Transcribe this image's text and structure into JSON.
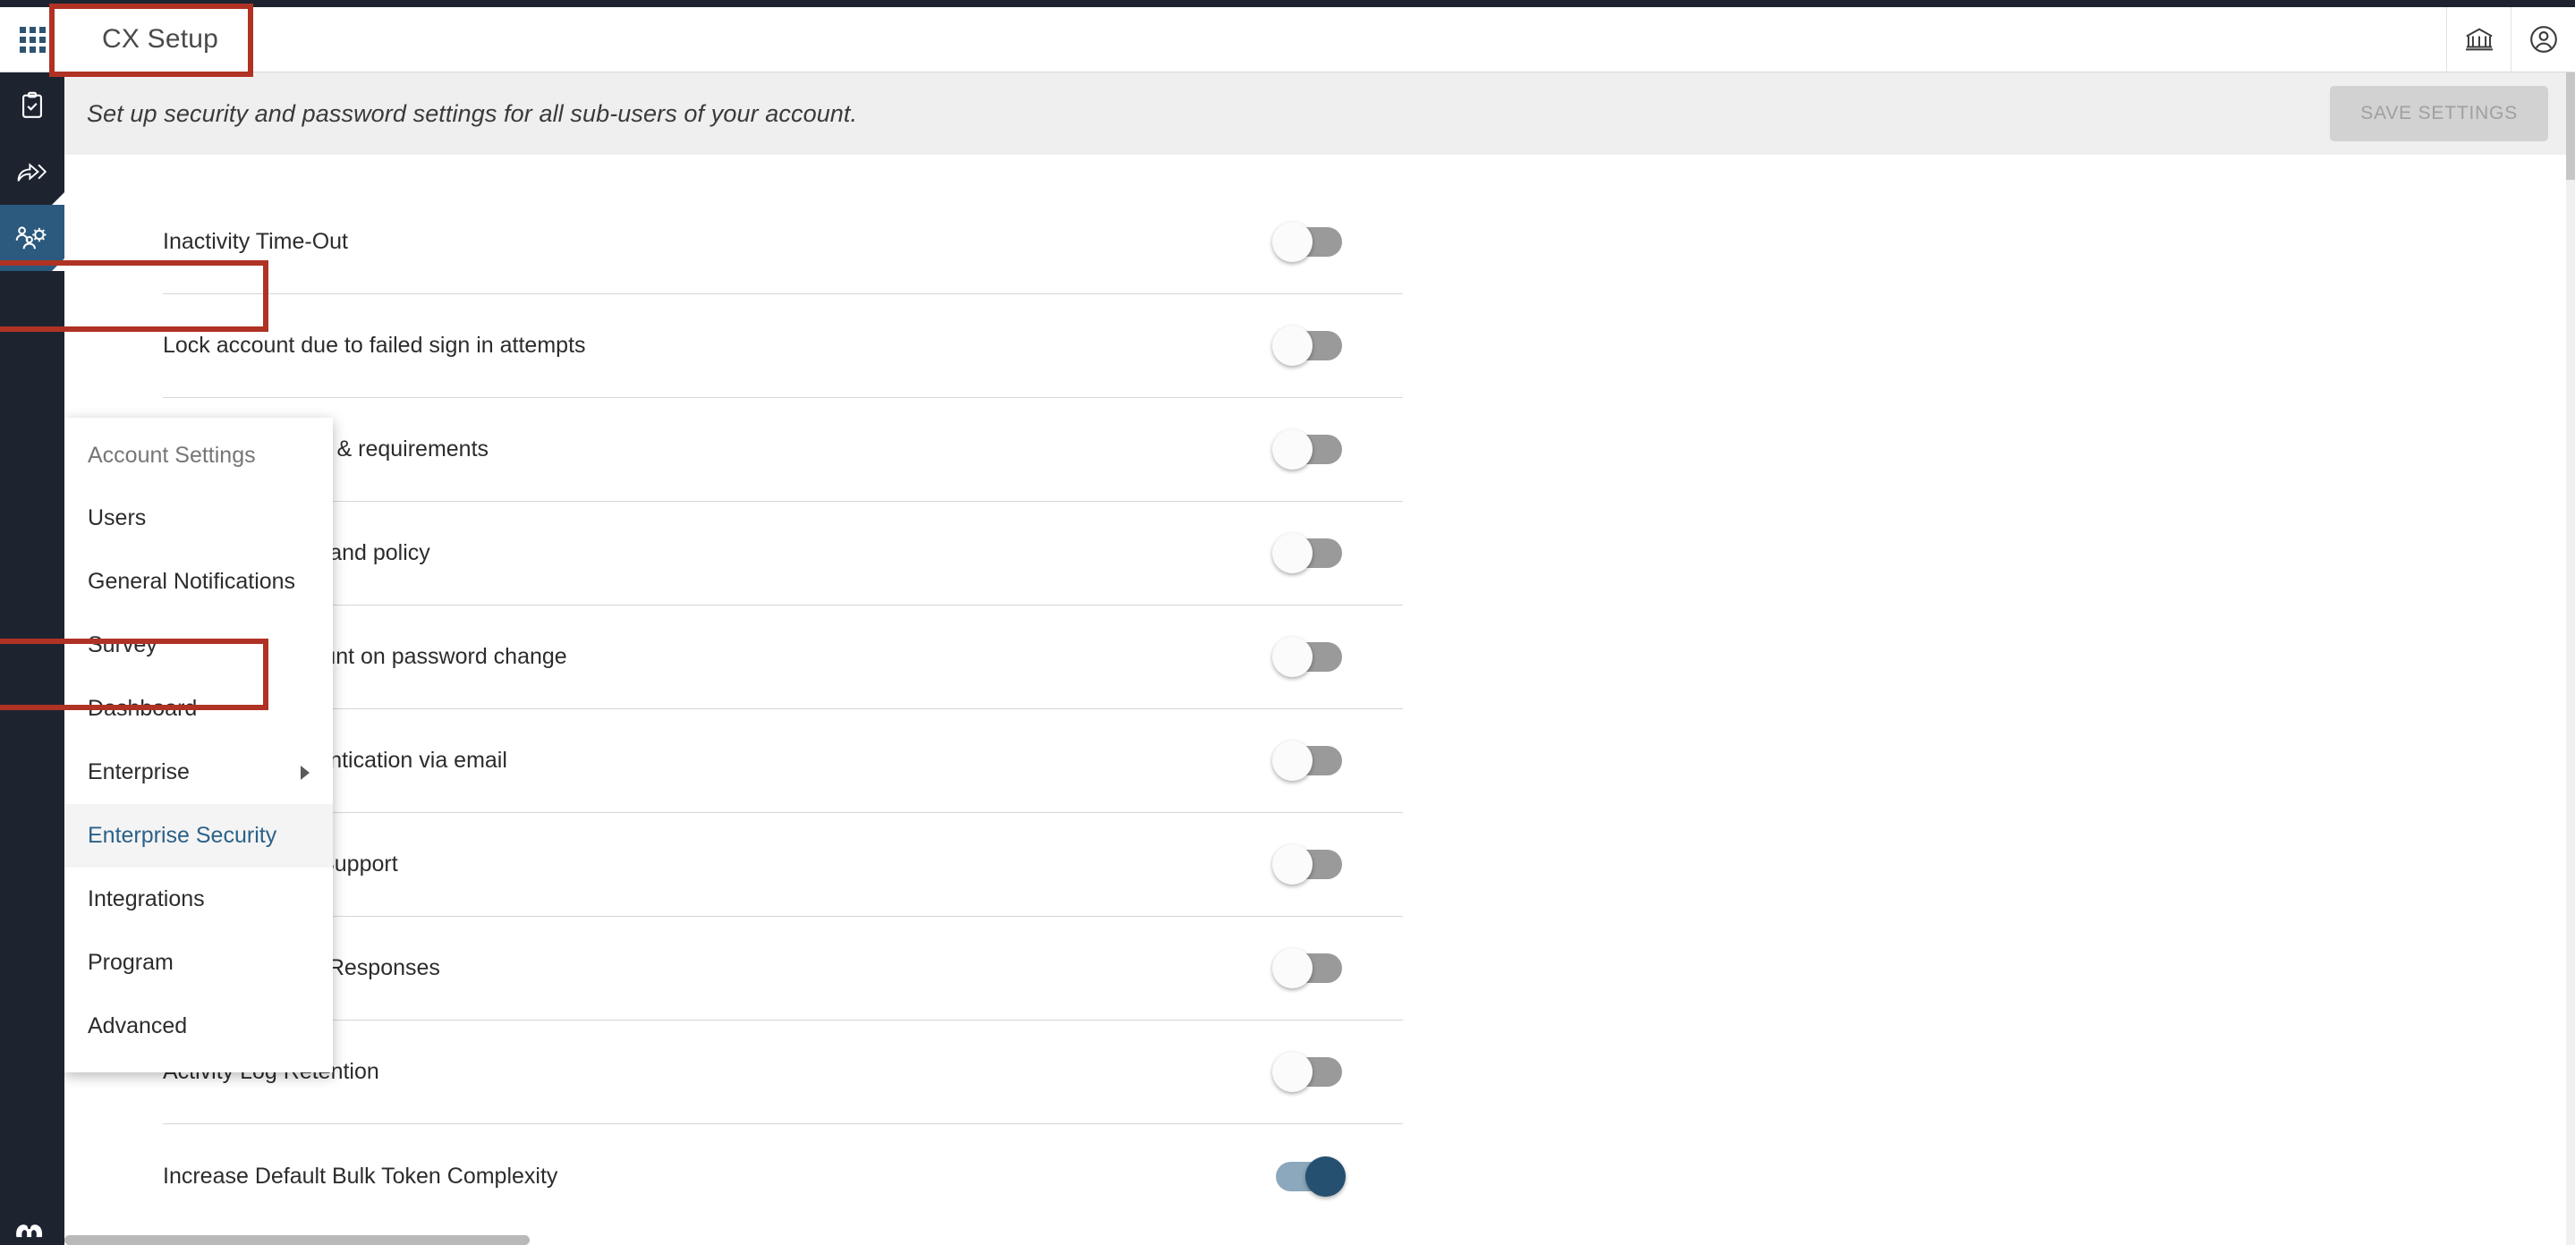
{
  "app": {
    "title": "CX Setup",
    "grid_icon": "grid-apps-icon",
    "institution_icon": "institution-icon",
    "account_icon": "user-account-icon"
  },
  "rail": {
    "items": [
      {
        "icon": "clipboard-check-icon",
        "active": false,
        "has_corner": false
      },
      {
        "icon": "share-forward-icon",
        "active": false,
        "has_corner": true
      },
      {
        "icon": "users-gear-icon",
        "active": true,
        "has_corner": true
      }
    ],
    "logo_icon": "brand-logo-icon"
  },
  "subheader": {
    "description": "Set up security and password settings for all sub-users of your account.",
    "save_label": "SAVE SETTINGS",
    "save_disabled": true
  },
  "menu": {
    "header": "Account Settings",
    "items": [
      {
        "label": "Users",
        "selected": false,
        "has_submenu": false
      },
      {
        "label": "General Notifications",
        "selected": false,
        "has_submenu": false
      },
      {
        "label": "Survey",
        "selected": false,
        "has_submenu": false
      },
      {
        "label": "Dashboard",
        "selected": false,
        "has_submenu": false
      },
      {
        "label": "Enterprise",
        "selected": false,
        "has_submenu": true
      },
      {
        "label": "Enterprise Security",
        "selected": true,
        "has_submenu": false
      },
      {
        "label": "Integrations",
        "selected": false,
        "has_submenu": false
      },
      {
        "label": "Program",
        "selected": false,
        "has_submenu": false
      },
      {
        "label": "Advanced",
        "selected": false,
        "has_submenu": false
      }
    ]
  },
  "settings": {
    "rows": [
      {
        "label": "Inactivity Time-Out",
        "on": false
      },
      {
        "label": "Lock account due to failed sign in attempts",
        "on": false
      },
      {
        "label": "Password format & requirements",
        "on": false
      },
      {
        "label": "Password reuse and policy",
        "on": false
      },
      {
        "label": "Sign out of account on password change",
        "on": false
      },
      {
        "label": "Two-factor authentication via email",
        "on": false
      },
      {
        "label": "Single Sign-On Support",
        "on": false
      },
      {
        "label": "PII Redaction In Responses",
        "on": false
      },
      {
        "label": "Activity Log Retention",
        "on": false
      },
      {
        "label": "Increase Default Bulk Token Complexity",
        "on": true
      }
    ]
  },
  "colors": {
    "rail_bg": "#1d2430",
    "rail_active": "#2b5a7e",
    "accent_blue": "#2b6189",
    "toggle_on_track": "#8ba8bc",
    "toggle_on_knob": "#255070",
    "toggle_off": "#9a9a9a",
    "annotation_red": "#b03224",
    "subheader_bg": "#efefef"
  }
}
